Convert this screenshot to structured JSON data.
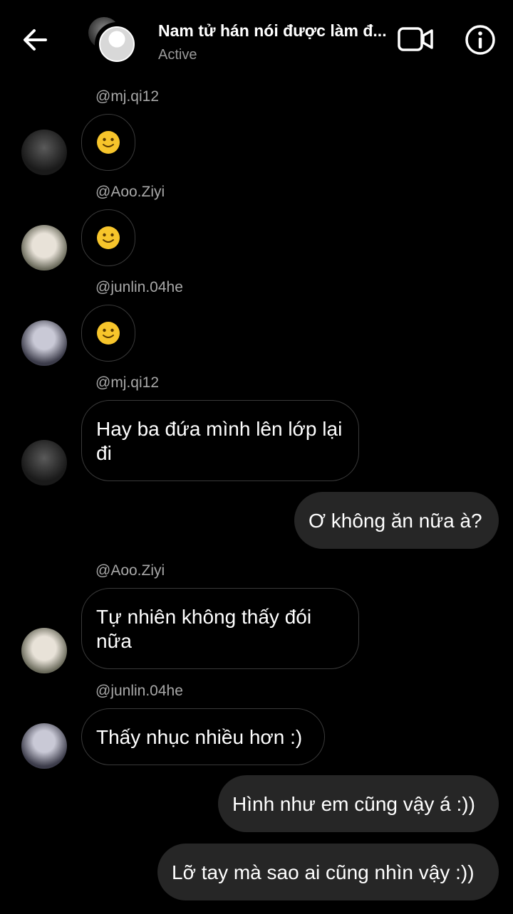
{
  "header": {
    "title": "Nam tử hán nói được làm đ...",
    "status": "Active"
  },
  "messages": [
    {
      "sender": "@mj.qi12",
      "text": "🙂",
      "type": "emoji"
    },
    {
      "sender": "@Aoo.Ziyi",
      "text": "🙂",
      "type": "emoji"
    },
    {
      "sender": "@junlin.04he",
      "text": "🙂",
      "type": "emoji"
    },
    {
      "sender": "@mj.qi12",
      "text": "Hay ba đứa mình lên lớp lại đi",
      "type": "text"
    },
    {
      "sender": "me",
      "text": "Ơ không ăn nữa à?",
      "type": "out"
    },
    {
      "sender": "@Aoo.Ziyi",
      "text": "Tự nhiên không thấy đói nữa",
      "type": "text"
    },
    {
      "sender": "@junlin.04he",
      "text": "Thấy nhục nhiều hơn :)",
      "type": "text"
    },
    {
      "sender": "me",
      "text": "Hình như em cũng vậy á :))",
      "type": "out"
    },
    {
      "sender": "me",
      "text": "Lỡ tay mà sao ai cũng nhìn vậy :))",
      "type": "out"
    }
  ],
  "colors": {
    "background": "#000000",
    "outgoing_bubble": "#262626",
    "incoming_border": "#3a3a3a",
    "username": "#a8a8a8"
  },
  "icons": [
    "back-arrow-icon",
    "video-call-icon",
    "info-icon",
    "slightly-smiling-face-icon"
  ]
}
